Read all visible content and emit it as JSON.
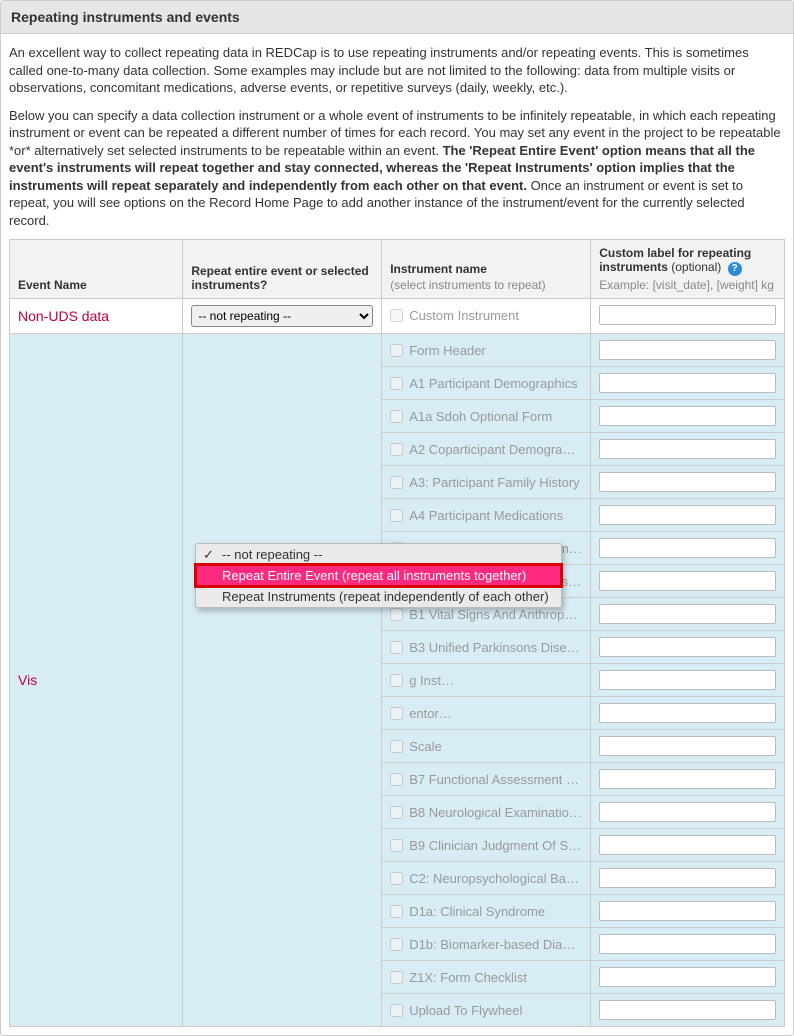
{
  "header": {
    "title": "Repeating instruments and events"
  },
  "intro": {
    "p1": "An excellent way to collect repeating data in REDCap is to use repeating instruments and/or repeating events. This is sometimes called one-to-many data collection. Some examples may include but are not limited to the following: data from multiple visits or observations, concomitant medications, adverse events, or repetitive surveys (daily, weekly, etc.).",
    "p2a": "Below you can specify a data collection instrument or a whole event of instruments to be infinitely repeatable, in which each repeating instrument or event can be repeated a different number of times for each record. You may set any event in the project to be repeatable *or* alternatively set selected instruments to be repeatable within an event. ",
    "p2b": "The 'Repeat Entire Event' option means that all the event's instruments will repeat together and stay connected, whereas the 'Repeat Instruments' option implies that the instruments will repeat separately and independently from each other on that event.",
    "p2c": " Once an instrument or event is set to repeat, you will see options on the Record Home Page to add another instance of the instrument/event for the currently selected record."
  },
  "columns": {
    "event": "Event Name",
    "repeat": "Repeat entire event or selected instruments?",
    "inst": "Instrument name",
    "inst_sub": "(select instruments to repeat)",
    "custom": "Custom label for repeating instruments",
    "custom_opt": " (optional)",
    "custom_sub": "Example: [visit_date], [weight] kg"
  },
  "help_glyph": "?",
  "rows": [
    {
      "event": "Non-UDS data",
      "select_value": "-- not repeating --",
      "instruments": [
        {
          "label": "Custom Instrument"
        }
      ]
    },
    {
      "event": "Vis",
      "select_value": "-- not repeating --",
      "instruments": [
        {
          "label": "Form Header"
        },
        {
          "label": "A1 Participant Demographics"
        },
        {
          "label": "A1a Sdoh Optional Form"
        },
        {
          "label": "A2 Coparticipant Demographics"
        },
        {
          "label": "A3: Participant Family History"
        },
        {
          "label": "A4 Participant Medications"
        },
        {
          "label": "A4a: ADRD Specific Treatments"
        },
        {
          "label": "A5d2 Participant Health Histo…"
        },
        {
          "label": "B1 Vital Signs And Anthropom…"
        },
        {
          "label": "B3 Unified Parkinsons Diseas…"
        },
        {
          "label": "g Inst…"
        },
        {
          "label": "entor…"
        },
        {
          "label": "Scale"
        },
        {
          "label": "B7 Functional Assessment Sca…"
        },
        {
          "label": "B8 Neurological Examination …"
        },
        {
          "label": "B9 Clinician Judgment Of Sym…"
        },
        {
          "label": "C2: Neuropsychological Batte…"
        },
        {
          "label": "D1a: Clinical Syndrome"
        },
        {
          "label": "D1b: Biomarker-based Diagn…"
        },
        {
          "label": "Z1X: Form Checklist"
        },
        {
          "label": "Upload To Flywheel"
        }
      ]
    }
  ],
  "dropdown": {
    "opt0": "-- not repeating --",
    "opt1": "Repeat Entire Event (repeat all instruments together)",
    "opt2": "Repeat Instruments (repeat independently of each other)"
  }
}
